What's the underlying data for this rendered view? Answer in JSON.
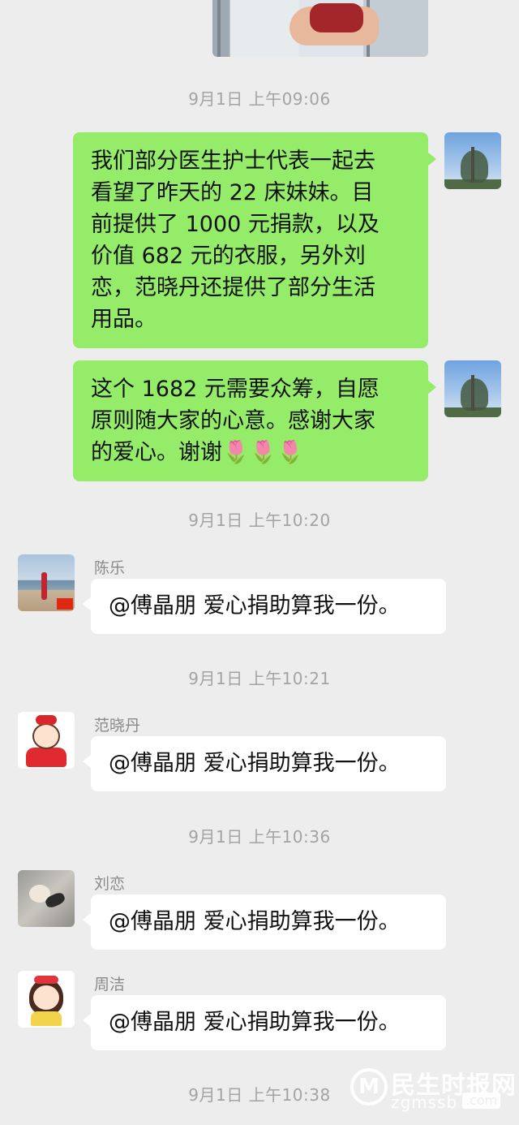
{
  "timestamps": [
    "9月1日 上午09:06",
    "9月1日 上午10:20",
    "9月1日 上午10:21",
    "9月1日 上午10:36",
    "9月1日 上午10:38"
  ],
  "outgoing": [
    {
      "lines": [
        "我们部分医生护士代表一起去",
        "看望了昨天的 22 床妹妹。目",
        "前提供了 1000 元捐款，以及",
        "价值 682 元的衣服，另外刘",
        "恋，范晓丹还提供了部分生活",
        "用品。"
      ]
    },
    {
      "lines": [
        "这个 1682 元需要众筹，自愿",
        "原则随大家的心意。感谢大家",
        "的爱心。谢谢"
      ],
      "emoji": "🌷🌷🌷"
    }
  ],
  "incoming": [
    {
      "nickname": "陈乐",
      "text": "@傅晶朋  爱心捐助算我一份。"
    },
    {
      "nickname": "范晓丹",
      "text": "@傅晶朋  爱心捐助算我一份。"
    },
    {
      "nickname": "刘恋",
      "text": "@傅晶朋  爱心捐助算我一份。"
    },
    {
      "nickname": "周洁",
      "text": "@傅晶朋  爱心捐助算我一份。"
    }
  ],
  "watermark": {
    "brand": "民生时报网",
    "domain": "zgmssb",
    "tld": ".com",
    "logo_letter": "M"
  },
  "colors": {
    "background": "#ededed",
    "outgoing_bubble": "#95ec69",
    "incoming_bubble": "#ffffff",
    "timestamp": "#a3a3a3",
    "nickname": "#8a8a8a"
  },
  "icons": [
    "photo-thumbnail",
    "avatar-self",
    "avatar-chenle",
    "avatar-fanxiaodan",
    "avatar-liulian",
    "avatar-zhoujie",
    "tulip-emoji",
    "watermark-logo"
  ]
}
